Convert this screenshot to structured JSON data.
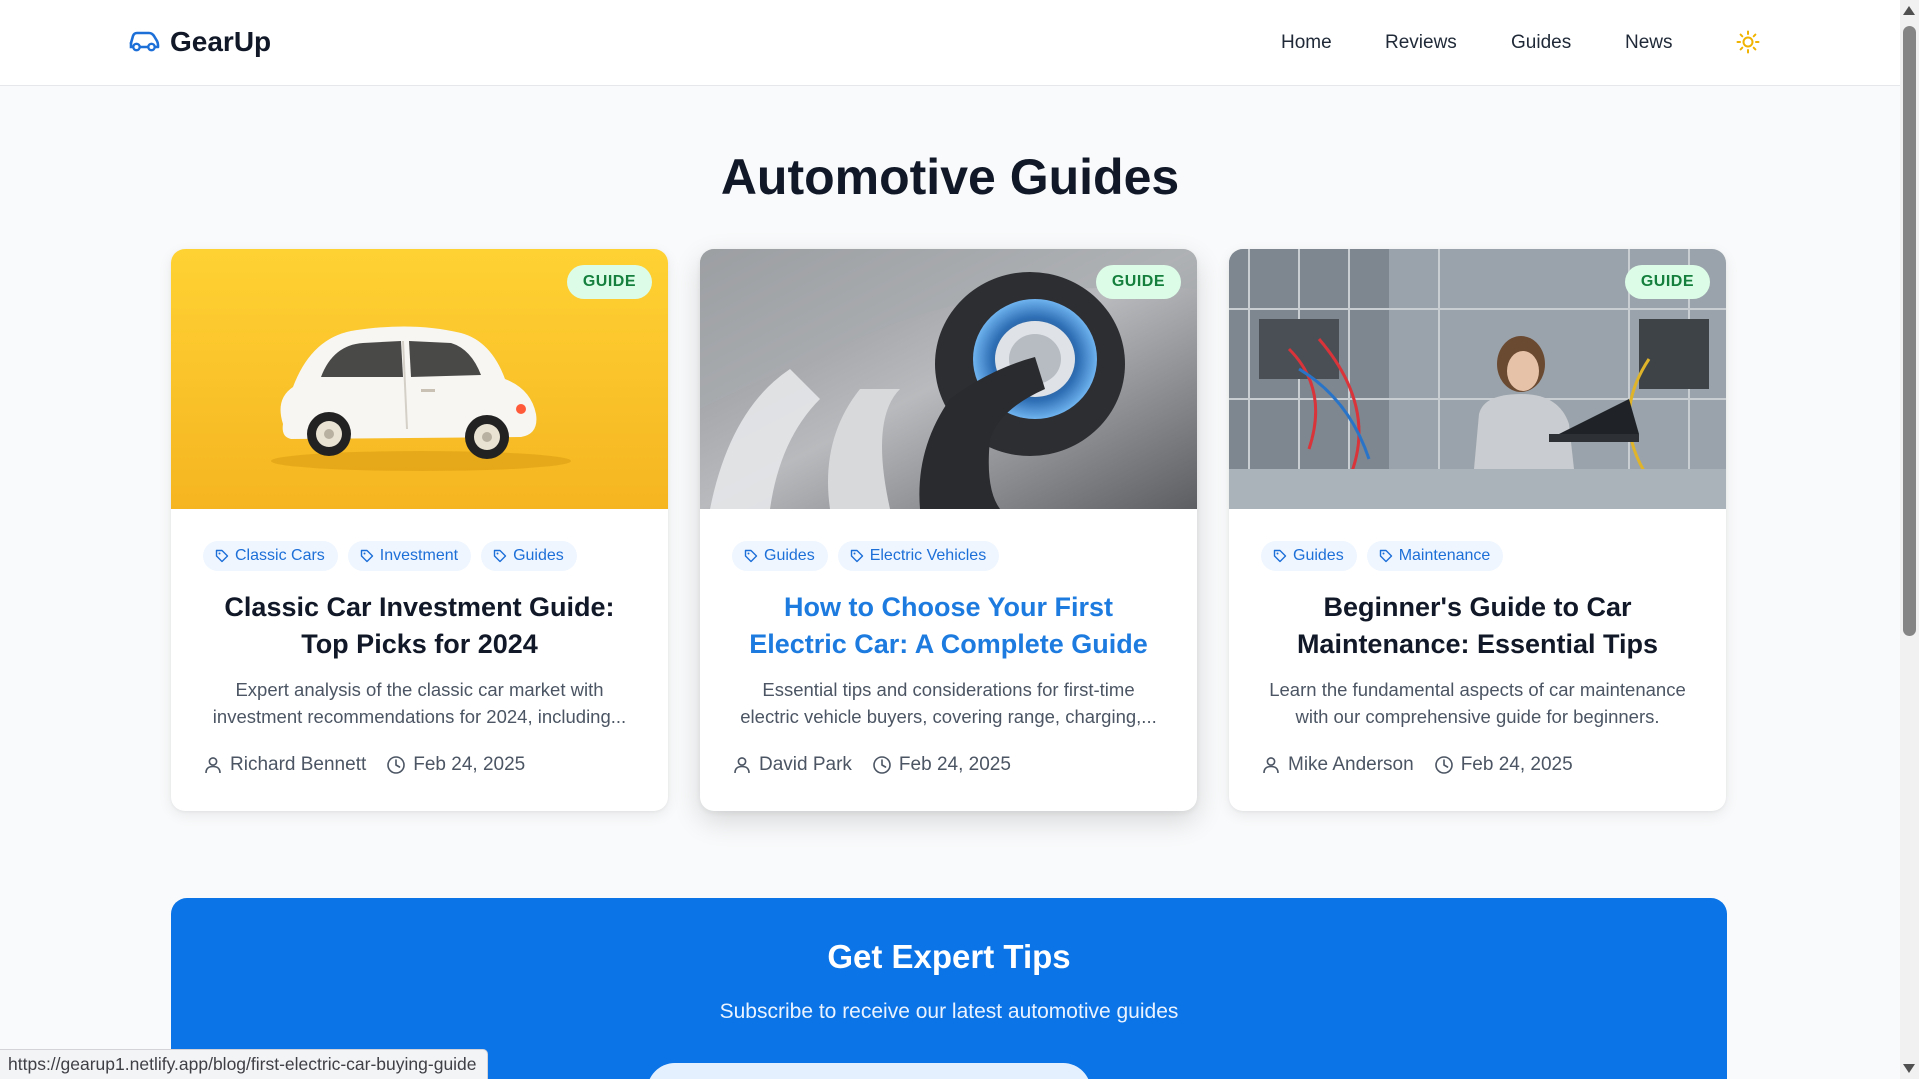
{
  "header": {
    "logo_icon": "car-icon",
    "brand": "GearUp",
    "nav": [
      "Home",
      "Reviews",
      "Guides",
      "News"
    ],
    "theme_icon": "sun-icon"
  },
  "page_title": "Automotive Guides",
  "cards": [
    {
      "badge": "GUIDE",
      "image": "white classic car on yellow background",
      "tags": [
        "Classic Cars",
        "Investment",
        "Guides"
      ],
      "title": "Classic Car Investment Guide: Top Picks for 2024",
      "description": "Expert analysis of the classic car market with investment recommendations for 2024, including...",
      "author": "Richard Bennett",
      "date": "Feb 24, 2025"
    },
    {
      "badge": "GUIDE",
      "image": "electric car charging plug",
      "tags": [
        "Guides",
        "Electric Vehicles"
      ],
      "title": "How to Choose Your First Electric Car: A Complete Guide",
      "description": "Essential tips and considerations for first-time electric vehicle buyers, covering range, charging,...",
      "author": "David Park",
      "date": "Feb 24, 2025"
    },
    {
      "badge": "GUIDE",
      "image": "engineer working at electronics lab",
      "tags": [
        "Guides",
        "Maintenance"
      ],
      "title": "Beginner's Guide to Car Maintenance: Essential Tips",
      "description": "Learn the fundamental aspects of car maintenance with our comprehensive guide for beginners.",
      "author": "Mike Anderson",
      "date": "Feb 24, 2025"
    }
  ],
  "newsletter": {
    "title": "Get Expert Tips",
    "subtitle": "Subscribe to receive our latest automotive guides"
  },
  "status_url": "https://gearup1.netlify.app/blog/first-electric-car-buying-guide",
  "colors": {
    "accent": "#0b74e6",
    "badge_bg": "#dcfce7",
    "badge_text": "#15803d",
    "tag_bg": "#eff6ff",
    "tag_text": "#1d6fd8",
    "sun": "#f0b400"
  }
}
